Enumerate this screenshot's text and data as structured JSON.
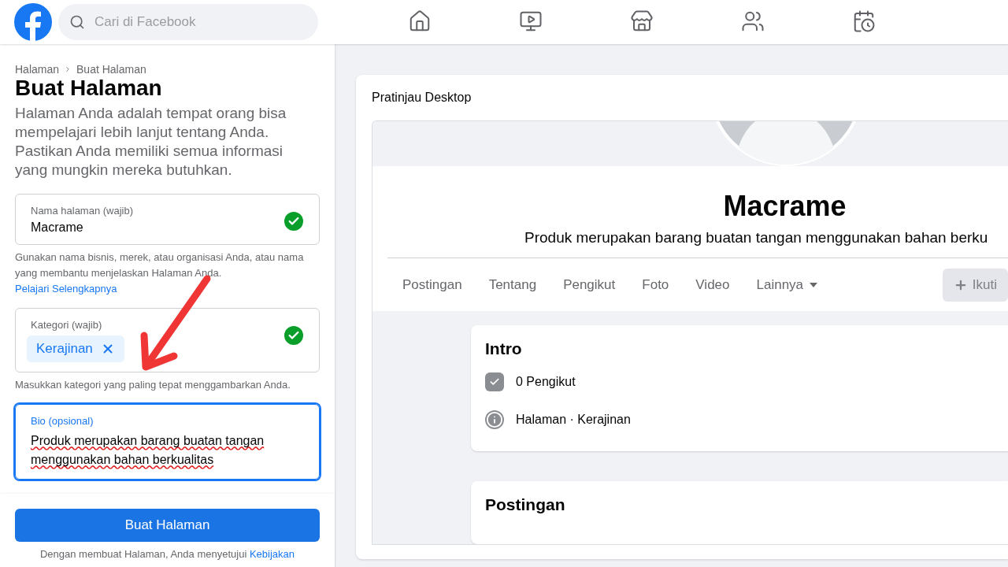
{
  "topbar": {
    "search": {
      "placeholder": "Cari di Facebook"
    },
    "nav": [
      {
        "kind": "home",
        "selected": false
      },
      {
        "kind": "video",
        "selected": false
      },
      {
        "kind": "store",
        "selected": false
      },
      {
        "kind": "groups",
        "selected": false
      },
      {
        "kind": "gaming",
        "selected": false
      }
    ]
  },
  "form": {
    "breadcrumb": [
      "Halaman",
      "Buat Halaman"
    ],
    "title": "Buat Halaman",
    "intro": "Halaman Anda adalah tempat orang bisa mempelajari lebih lanjut tentang Anda. Pastikan Anda memiliki semua informasi yang mungkin mereka butuhkan.",
    "name_field": {
      "label": "Nama halaman (wajib)",
      "value": "Macrame",
      "valid": true
    },
    "name_help": "Gunakan nama bisnis, merek, atau organisasi Anda, atau nama yang membantu menjelaskan Halaman Anda.",
    "name_help_link": "Pelajari Selengkapnya",
    "category_field": {
      "label": "Kategori (wajib)",
      "chips": [
        "Kerajinan"
      ],
      "valid": true
    },
    "category_help": "Masukkan kategori yang paling tepat menggambarkan Anda.",
    "bio_field": {
      "label": "Bio (opsional)",
      "value": "Produk merupakan barang buatan tangan menggunakan bahan berkualitas",
      "focused": true
    },
    "submit": "Buat Halaman",
    "terms": "Dengan membuat Halaman, Anda menyetujui",
    "terms_link": "Kebijakan"
  },
  "preview": {
    "title": "Pratinjau Desktop",
    "page_name": "Macrame",
    "bio": "Produk merupakan barang buatan tangan menggunakan bahan berku",
    "tabs": [
      {
        "label": "Postingan",
        "kind": "tab"
      },
      {
        "label": "Tentang",
        "kind": "tab"
      },
      {
        "label": "Pengikut",
        "kind": "tab"
      },
      {
        "label": "Foto",
        "kind": "tab"
      },
      {
        "label": "Video",
        "kind": "tab"
      },
      {
        "label": "Lainnya",
        "kind": "menu"
      }
    ],
    "follow_button": {
      "label": "Ikuti",
      "disabled": true
    },
    "intro": {
      "title": "Intro",
      "items": [
        {
          "kind": "followers",
          "text": "0 Pengikut"
        },
        {
          "kind": "info",
          "text": "Halaman · Kerajinan"
        }
      ]
    },
    "posts_title": "Postingan"
  }
}
